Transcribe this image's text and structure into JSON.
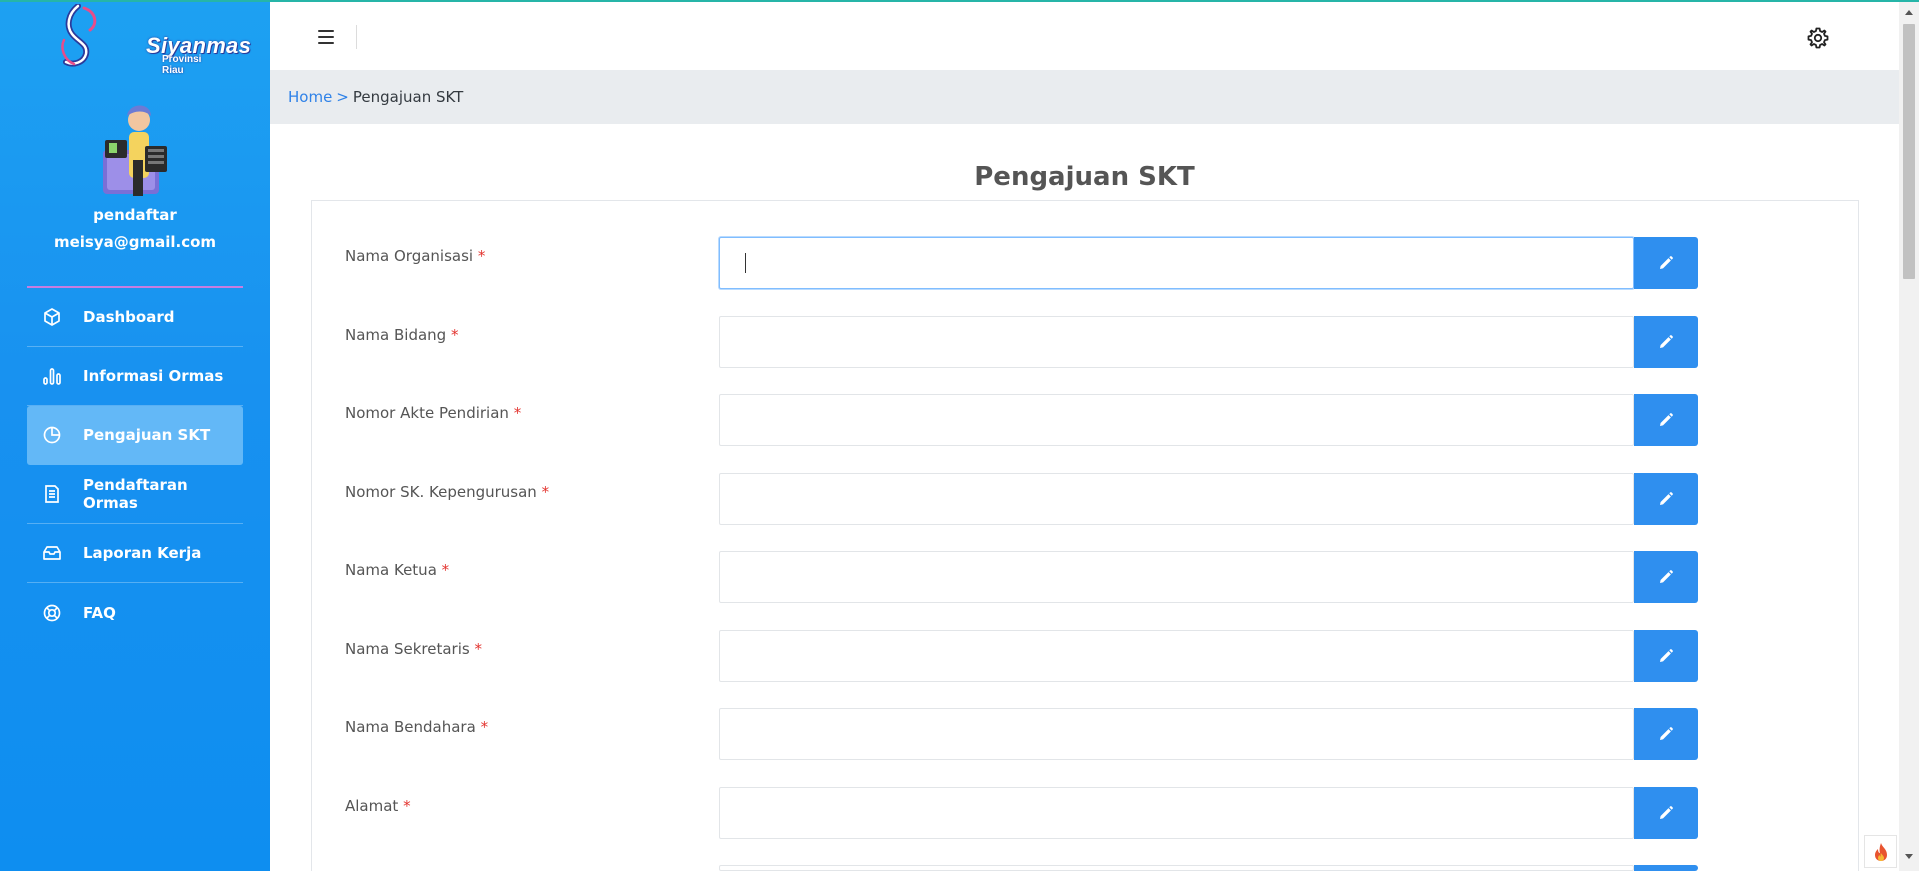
{
  "app": {
    "logo_text": "Siyanmas",
    "logo_subtext": "Provinsi Riau"
  },
  "user": {
    "name": "pendaftar",
    "email": "meisya@gmail.com"
  },
  "sidebar": {
    "items": [
      {
        "label": "Dashboard",
        "icon": "cube-icon",
        "active": false
      },
      {
        "label": "Informasi Ormas",
        "icon": "bar-chart-icon",
        "active": false
      },
      {
        "label": "Pengajuan SKT",
        "icon": "pie-chart-icon",
        "active": true
      },
      {
        "label": "Pendaftaran Ormas",
        "icon": "document-icon",
        "active": false
      },
      {
        "label": "Laporan Kerja",
        "icon": "inbox-icon",
        "active": false
      },
      {
        "label": "FAQ",
        "icon": "lifebuoy-icon",
        "active": false
      }
    ]
  },
  "breadcrumb": {
    "home": "Home",
    "separator": ">",
    "current": "Pengajuan SKT"
  },
  "main": {
    "title": "Pengajuan SKT",
    "required_mark": "*",
    "fields": [
      {
        "label": "Nama Organisasi",
        "value": ""
      },
      {
        "label": "Nama Bidang",
        "value": ""
      },
      {
        "label": "Nomor Akte Pendirian",
        "value": ""
      },
      {
        "label": "Nomor SK. Kepengurusan",
        "value": ""
      },
      {
        "label": "Nama Ketua",
        "value": ""
      },
      {
        "label": "Nama Sekretaris",
        "value": ""
      },
      {
        "label": "Nama Bendahara",
        "value": ""
      },
      {
        "label": "Alamat",
        "value": ""
      }
    ]
  },
  "colors": {
    "sidebar": "#1891f0",
    "active_item": "#63b8f7",
    "button": "#2f8fef",
    "link": "#2f82e8",
    "required": "#e3342f"
  }
}
